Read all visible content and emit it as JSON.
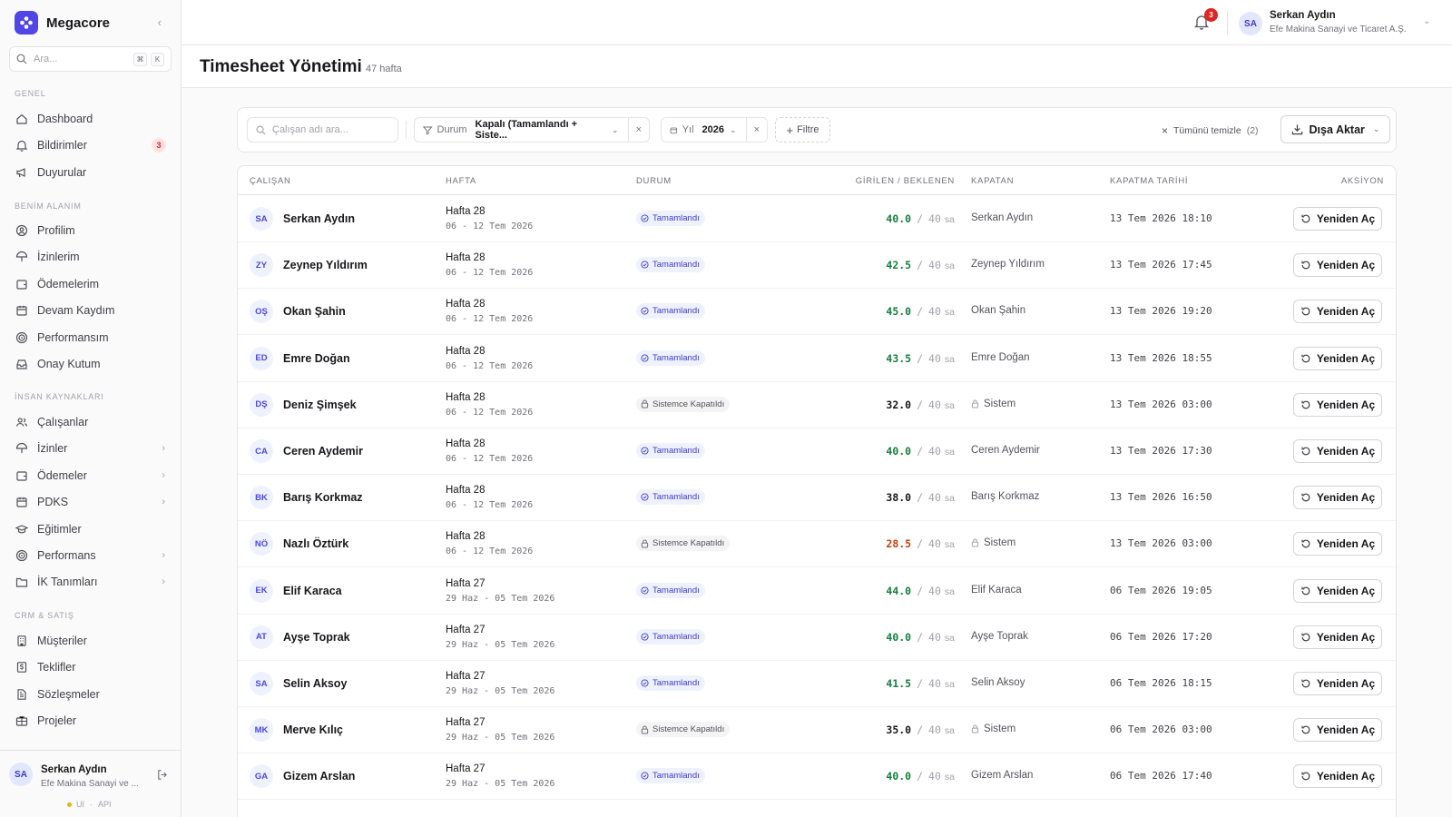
{
  "app": {
    "name": "Megacore"
  },
  "sidebar": {
    "search_placeholder": "Ara...",
    "kbd": [
      "⌘",
      "K"
    ],
    "sections": [
      {
        "title": "GENEL",
        "items": [
          {
            "label": "Dashboard",
            "icon": "home-icon"
          },
          {
            "label": "Bildirimler",
            "icon": "bell-icon",
            "badge": "3"
          },
          {
            "label": "Duyurular",
            "icon": "megaphone-icon"
          }
        ]
      },
      {
        "title": "BENİM ALANIM",
        "items": [
          {
            "label": "Profilim",
            "icon": "user-circle-icon"
          },
          {
            "label": "İzinlerim",
            "icon": "umbrella-icon"
          },
          {
            "label": "Ödemelerim",
            "icon": "wallet-icon"
          },
          {
            "label": "Devam Kaydım",
            "icon": "calendar-icon"
          },
          {
            "label": "Performansım",
            "icon": "target-icon"
          },
          {
            "label": "Onay Kutum",
            "icon": "inbox-icon"
          }
        ]
      },
      {
        "title": "İNSAN KAYNAKLARI",
        "items": [
          {
            "label": "Çalışanlar",
            "icon": "users-icon"
          },
          {
            "label": "İzinler",
            "icon": "umbrella-icon",
            "chevron": true
          },
          {
            "label": "Ödemeler",
            "icon": "wallet-icon",
            "chevron": true
          },
          {
            "label": "PDKS",
            "icon": "calendar-icon",
            "chevron": true
          },
          {
            "label": "Eğitimler",
            "icon": "graduation-cap-icon"
          },
          {
            "label": "Performans",
            "icon": "target-icon",
            "chevron": true
          },
          {
            "label": "İK Tanımları",
            "icon": "folder-icon",
            "chevron": true
          }
        ]
      },
      {
        "title": "CRM & SATIŞ",
        "items": [
          {
            "label": "Müşteriler",
            "icon": "building-icon"
          },
          {
            "label": "Teklifler",
            "icon": "dollar-doc-icon"
          },
          {
            "label": "Sözleşmeler",
            "icon": "file-icon"
          },
          {
            "label": "Projeler",
            "icon": "briefcase-icon"
          }
        ]
      }
    ],
    "user": {
      "initials": "SA",
      "name": "Serkan Aydın",
      "company": "Efe Makina Sanayi ve ..."
    },
    "status": {
      "ui": "UI",
      "api": "API"
    }
  },
  "header": {
    "notification_count": "3",
    "user": {
      "initials": "SA",
      "name": "Serkan Aydın",
      "company": "Efe Makina Sanayi ve Ticaret A.Ş."
    }
  },
  "page": {
    "title": "Timesheet Yönetimi",
    "count": "47 hafta"
  },
  "filters": {
    "search_placeholder": "Çalışan adı ara...",
    "status": {
      "label": "Durum",
      "value": "Kapalı (Tamamlandı + Siste..."
    },
    "year": {
      "label": "Yıl",
      "value": "2026"
    },
    "add_filter": "Filtre",
    "clear_all": "Tümünü temizle",
    "clear_count": "(2)",
    "export": "Dışa Aktar"
  },
  "table": {
    "columns": [
      "ÇALIŞAN",
      "HAFTA",
      "DURUM",
      "GİRİLEN / BEKLENEN",
      "KAPATAN",
      "KAPATMA TARİHİ",
      "AKSİYON"
    ],
    "action_label": "Yeniden Aç",
    "hours_unit": "sa",
    "colors": {
      "over": "#15803d",
      "normal": "#18181b",
      "under": "#c2410c"
    },
    "rows": [
      {
        "initials": "SA",
        "name": "Serkan Aydın",
        "week": "Hafta 28",
        "range": "06 - 12 Tem 2026",
        "status": "Tamamlandı",
        "status_type": "ok",
        "entered": "40.0",
        "expected": "40",
        "hours_state": "over",
        "closer": "Serkan Aydın",
        "closer_system": false,
        "closed_at": "13 Tem 2026 18:10"
      },
      {
        "initials": "ZY",
        "name": "Zeynep Yıldırım",
        "week": "Hafta 28",
        "range": "06 - 12 Tem 2026",
        "status": "Tamamlandı",
        "status_type": "ok",
        "entered": "42.5",
        "expected": "40",
        "hours_state": "over",
        "closer": "Zeynep Yıldırım",
        "closer_system": false,
        "closed_at": "13 Tem 2026 17:45"
      },
      {
        "initials": "OŞ",
        "name": "Okan Şahin",
        "week": "Hafta 28",
        "range": "06 - 12 Tem 2026",
        "status": "Tamamlandı",
        "status_type": "ok",
        "entered": "45.0",
        "expected": "40",
        "hours_state": "over",
        "closer": "Okan Şahin",
        "closer_system": false,
        "closed_at": "13 Tem 2026 19:20"
      },
      {
        "initials": "ED",
        "name": "Emre Doğan",
        "week": "Hafta 28",
        "range": "06 - 12 Tem 2026",
        "status": "Tamamlandı",
        "status_type": "ok",
        "entered": "43.5",
        "expected": "40",
        "hours_state": "over",
        "closer": "Emre Doğan",
        "closer_system": false,
        "closed_at": "13 Tem 2026 18:55"
      },
      {
        "initials": "DŞ",
        "name": "Deniz Şimşek",
        "week": "Hafta 28",
        "range": "06 - 12 Tem 2026",
        "status": "Sistemce Kapatıldı",
        "status_type": "sys",
        "entered": "32.0",
        "expected": "40",
        "hours_state": "normal",
        "closer": "Sistem",
        "closer_system": true,
        "closed_at": "13 Tem 2026 03:00"
      },
      {
        "initials": "CA",
        "name": "Ceren Aydemir",
        "week": "Hafta 28",
        "range": "06 - 12 Tem 2026",
        "status": "Tamamlandı",
        "status_type": "ok",
        "entered": "40.0",
        "expected": "40",
        "hours_state": "over",
        "closer": "Ceren Aydemir",
        "closer_system": false,
        "closed_at": "13 Tem 2026 17:30"
      },
      {
        "initials": "BK",
        "name": "Barış Korkmaz",
        "week": "Hafta 28",
        "range": "06 - 12 Tem 2026",
        "status": "Tamamlandı",
        "status_type": "ok",
        "entered": "38.0",
        "expected": "40",
        "hours_state": "normal",
        "closer": "Barış Korkmaz",
        "closer_system": false,
        "closed_at": "13 Tem 2026 16:50"
      },
      {
        "initials": "NÖ",
        "name": "Nazlı Öztürk",
        "week": "Hafta 28",
        "range": "06 - 12 Tem 2026",
        "status": "Sistemce Kapatıldı",
        "status_type": "sys",
        "entered": "28.5",
        "expected": "40",
        "hours_state": "under",
        "closer": "Sistem",
        "closer_system": true,
        "closed_at": "13 Tem 2026 03:00"
      },
      {
        "initials": "EK",
        "name": "Elif Karaca",
        "week": "Hafta 27",
        "range": "29 Haz - 05 Tem 2026",
        "status": "Tamamlandı",
        "status_type": "ok",
        "entered": "44.0",
        "expected": "40",
        "hours_state": "over",
        "closer": "Elif Karaca",
        "closer_system": false,
        "closed_at": "06 Tem 2026 19:05"
      },
      {
        "initials": "AT",
        "name": "Ayşe Toprak",
        "week": "Hafta 27",
        "range": "29 Haz - 05 Tem 2026",
        "status": "Tamamlandı",
        "status_type": "ok",
        "entered": "40.0",
        "expected": "40",
        "hours_state": "over",
        "closer": "Ayşe Toprak",
        "closer_system": false,
        "closed_at": "06 Tem 2026 17:20"
      },
      {
        "initials": "SA",
        "name": "Selin Aksoy",
        "week": "Hafta 27",
        "range": "29 Haz - 05 Tem 2026",
        "status": "Tamamlandı",
        "status_type": "ok",
        "entered": "41.5",
        "expected": "40",
        "hours_state": "over",
        "closer": "Selin Aksoy",
        "closer_system": false,
        "closed_at": "06 Tem 2026 18:15"
      },
      {
        "initials": "MK",
        "name": "Merve Kılıç",
        "week": "Hafta 27",
        "range": "29 Haz - 05 Tem 2026",
        "status": "Sistemce Kapatıldı",
        "status_type": "sys",
        "entered": "35.0",
        "expected": "40",
        "hours_state": "normal",
        "closer": "Sistem",
        "closer_system": true,
        "closed_at": "06 Tem 2026 03:00"
      },
      {
        "initials": "GA",
        "name": "Gizem Arslan",
        "week": "Hafta 27",
        "range": "29 Haz - 05 Tem 2026",
        "status": "Tamamlandı",
        "status_type": "ok",
        "entered": "40.0",
        "expected": "40",
        "hours_state": "over",
        "closer": "Gizem Arslan",
        "closer_system": false,
        "closed_at": "06 Tem 2026 17:40"
      }
    ]
  }
}
